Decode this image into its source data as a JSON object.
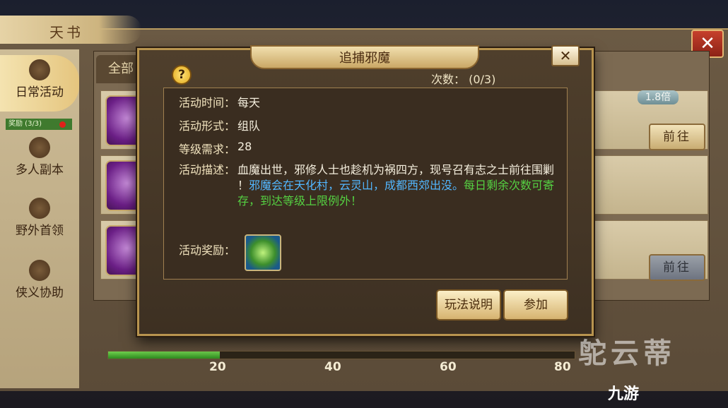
{
  "window": {
    "title": "天书",
    "close_glyph": "✕"
  },
  "sidebar": {
    "items": [
      {
        "label": "日常活动",
        "icon": "scroll-icon",
        "active": true
      },
      {
        "label": "多人副本",
        "icon": "shield-icon",
        "active": false
      },
      {
        "label": "野外首领",
        "icon": "demon-mask-icon",
        "active": false
      },
      {
        "label": "侠义协助",
        "icon": "hat-icon",
        "active": false
      }
    ],
    "reward_tag": "奖励 (3/3)"
  },
  "content": {
    "tab_all": "全部",
    "multiplier_badge": "1.8倍",
    "go_buttons": [
      "前往",
      "前往"
    ]
  },
  "progress": {
    "ticks": [
      "20",
      "40",
      "60",
      "80"
    ],
    "fill_fraction": 0.24
  },
  "modal": {
    "title": "追捕邪魔",
    "close_glyph": "✕",
    "help_glyph": "?",
    "count_label": "次数：",
    "count_value": "(0/3)",
    "fields": {
      "time_label": "活动时间：",
      "time_value": "每天",
      "form_label": "活动形式：",
      "form_value": "组队",
      "level_label": "等级需求：",
      "level_value": "28",
      "desc_label": "活动描述：",
      "desc_line1": "血魔出世，邪修人士也趁机为祸四方，现号召有志之士前往围剿",
      "desc_line2_white": "！",
      "desc_line2_blue": "邪魔会在天化村，云灵山，成都西郊出没。",
      "desc_line2_green": "每日剩余次数可寄",
      "desc_line3": "存，到达等级上限例外！",
      "reward_label": "活动奖励："
    },
    "buttons": {
      "rules": "玩法说明",
      "join": "参加"
    }
  },
  "watermark": {
    "brand": "九游",
    "overlay": "鸵云蒂"
  },
  "colors": {
    "accent_gold": "#b8944f",
    "blue_text": "#52b7ff",
    "green_text": "#55d142",
    "close_red": "#c6402c"
  }
}
